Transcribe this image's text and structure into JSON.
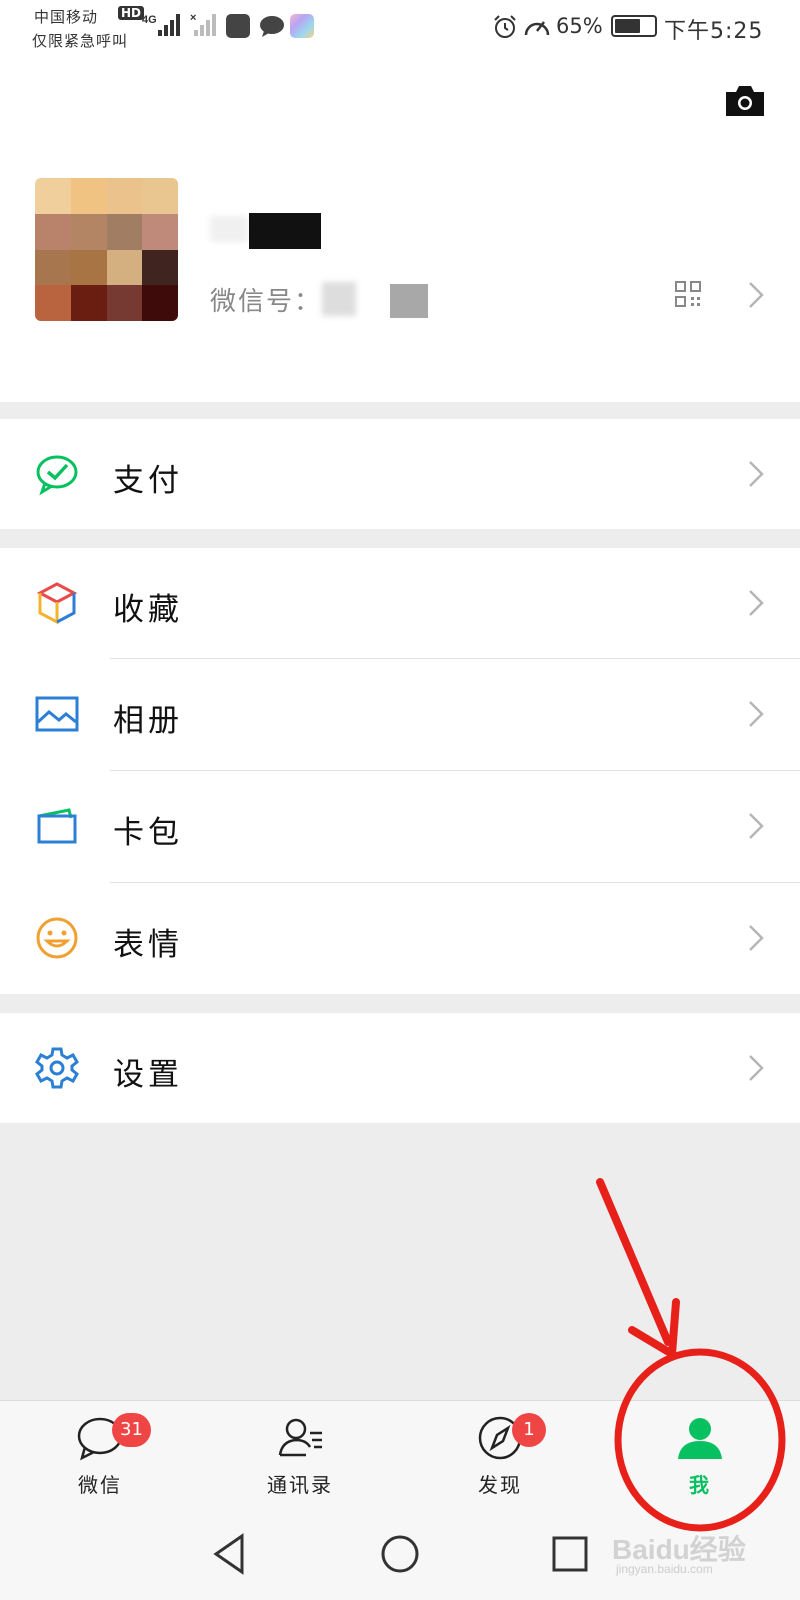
{
  "status_bar": {
    "carrier": "中国移动",
    "hd": "HD",
    "emergency": "仅限紧急呼叫",
    "network": "4G",
    "battery_percent": "65%",
    "battery_level": 0.65,
    "time": "下午5:25"
  },
  "profile": {
    "wechat_id_label": "微信号：",
    "camera_icon": "camera-icon",
    "qr_icon": "qr-code-icon"
  },
  "menu": {
    "pay": {
      "label": "支付",
      "icon": "pay-icon",
      "color": "#07c160"
    },
    "favorites": {
      "label": "收藏",
      "icon": "favorites-cube-icon"
    },
    "album": {
      "label": "相册",
      "icon": "album-icon",
      "color": "#2b7fd4"
    },
    "cards": {
      "label": "卡包",
      "icon": "card-wallet-icon",
      "color": "#2b7fd4"
    },
    "stickers": {
      "label": "表情",
      "icon": "smiley-icon",
      "color": "#f0a030"
    },
    "settings": {
      "label": "设置",
      "icon": "gear-icon",
      "color": "#2b7fd4"
    }
  },
  "bottom_nav": {
    "tabs": [
      {
        "label": "微信",
        "badge": "31",
        "icon": "chat-icon"
      },
      {
        "label": "通讯录",
        "badge": "",
        "icon": "contacts-icon"
      },
      {
        "label": "发现",
        "badge": "1",
        "icon": "compass-icon"
      },
      {
        "label": "我",
        "badge": "",
        "icon": "person-icon",
        "active": true
      }
    ],
    "active_color": "#07c160",
    "badge_color": "#f04545"
  },
  "annotation": {
    "color": "#e8201a",
    "watermark": "Baidu经验",
    "watermark_sub": "jingyan.baidu.com"
  }
}
